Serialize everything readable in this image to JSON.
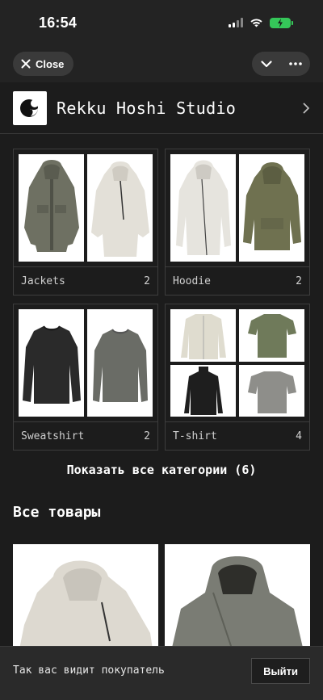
{
  "status": {
    "time": "16:54"
  },
  "topbar": {
    "close_label": "Close"
  },
  "store": {
    "name": "Rekku Hoshi Studio"
  },
  "categories": [
    {
      "name": "Jackets",
      "count": "2"
    },
    {
      "name": "Hoodie",
      "count": "2"
    },
    {
      "name": "Sweatshirt",
      "count": "2"
    },
    {
      "name": "T-shirt",
      "count": "4"
    }
  ],
  "show_all_label": "Показать все категории (6)",
  "all_products_title": "Все товары",
  "preview": {
    "text": "Так вас видит покупатель",
    "exit_label": "Выйти"
  },
  "colors": {
    "background": "#1c1c1c",
    "battery": "#35c759",
    "card_border": "#3d3d3d"
  }
}
